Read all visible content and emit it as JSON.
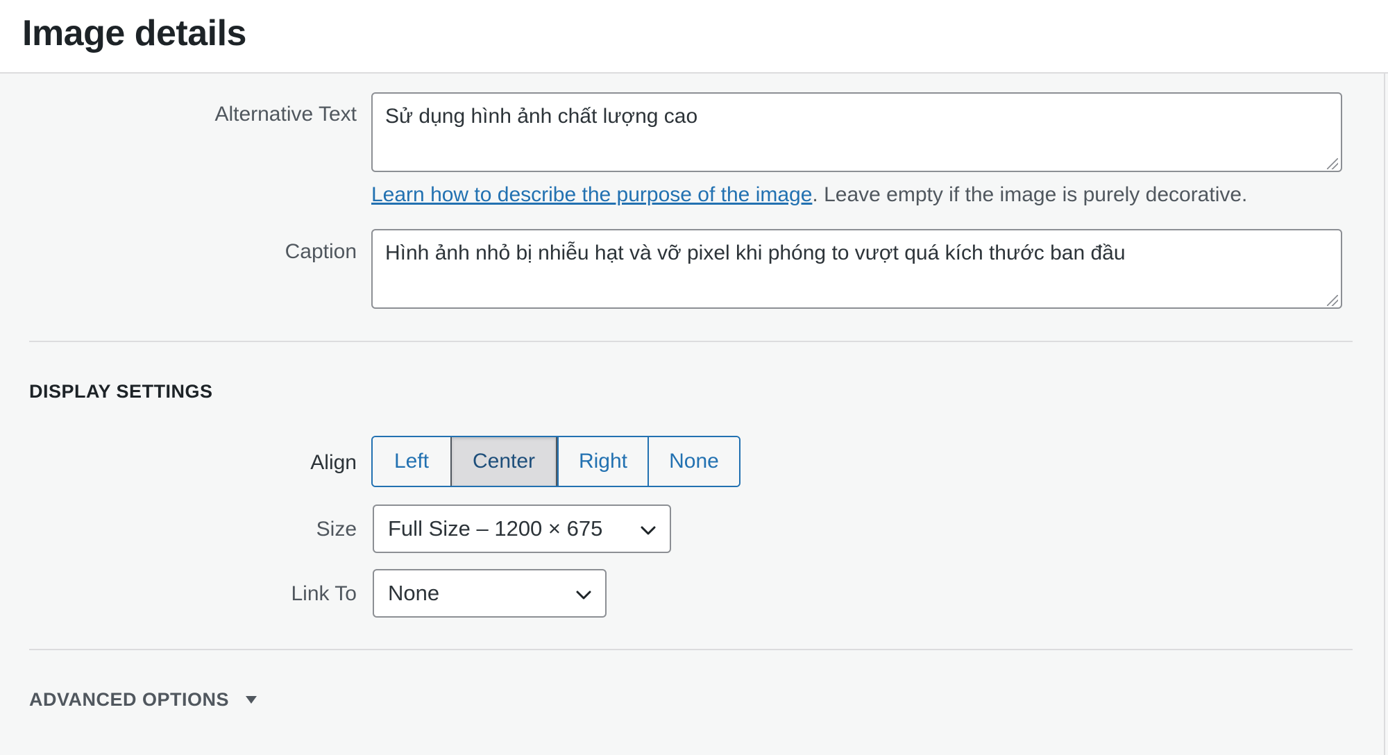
{
  "header": {
    "title": "Image details"
  },
  "alt_text": {
    "label": "Alternative Text",
    "value": "Sử dụng hình ảnh chất lượng cao",
    "help_link": "Learn how to describe the purpose of the image",
    "help_text": ". Leave empty if the image is purely decorative."
  },
  "caption": {
    "label": "Caption",
    "value": "Hình ảnh nhỏ bị nhiễu hạt và vỡ pixel khi phóng to vượt quá kích thước ban đầu"
  },
  "display_settings": {
    "title": "DISPLAY SETTINGS",
    "align": {
      "label": "Align",
      "options": [
        "Left",
        "Center",
        "Right",
        "None"
      ],
      "selected": "Center"
    },
    "size": {
      "label": "Size",
      "value": "Full Size – 1200 × 675"
    },
    "link_to": {
      "label": "Link To",
      "value": "None"
    }
  },
  "advanced": {
    "title": "ADVANCED OPTIONS"
  },
  "icons": {
    "size_select": "chevron-down-icon",
    "link_select": "chevron-down-icon",
    "advanced_toggle": "triangle-down-icon"
  }
}
